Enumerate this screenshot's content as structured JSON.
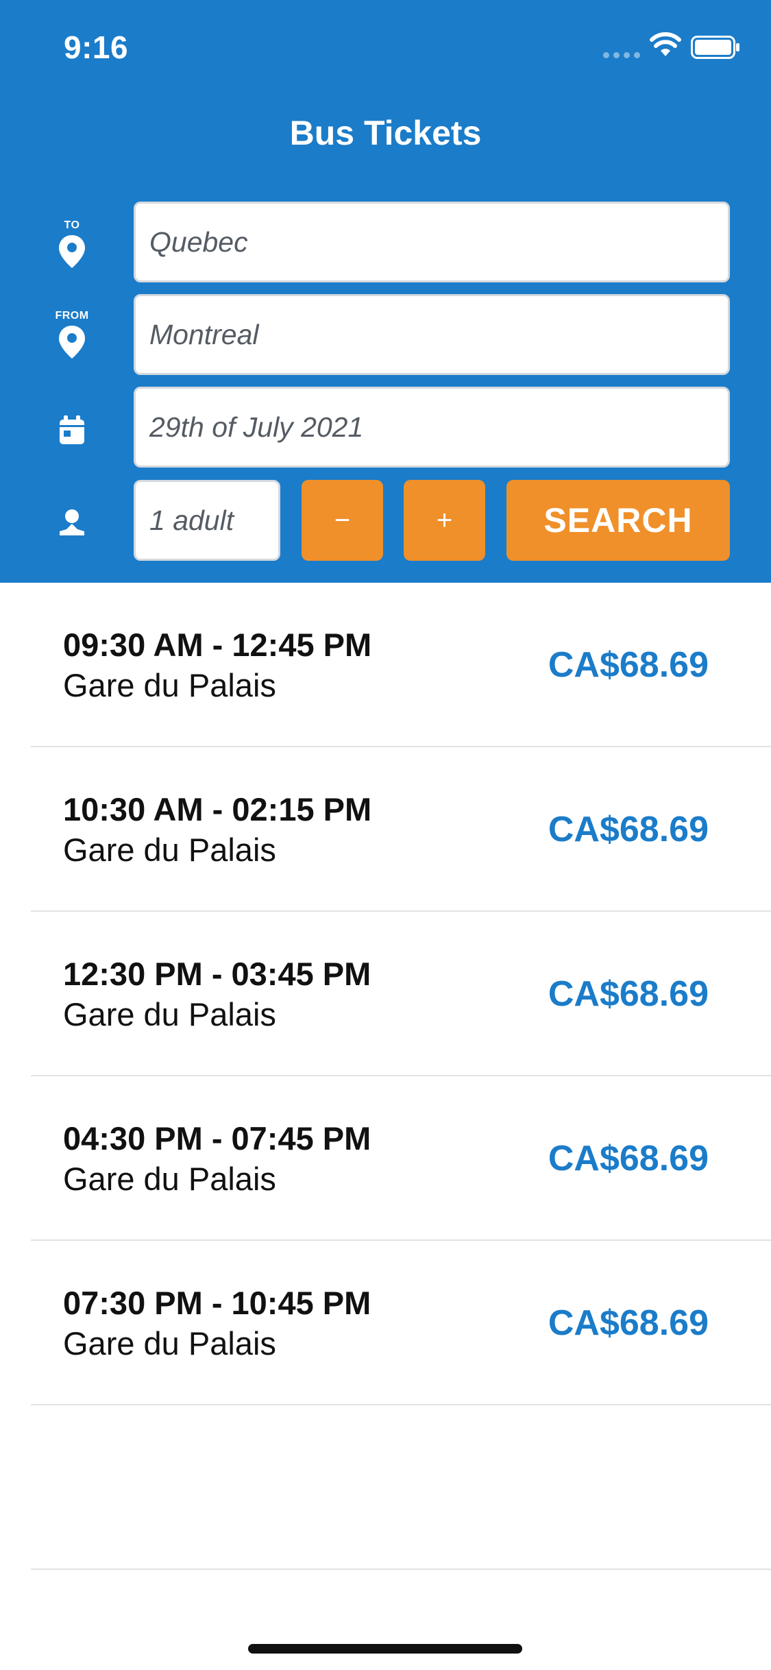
{
  "status_bar": {
    "time": "9:16"
  },
  "header": {
    "title": "Bus Tickets"
  },
  "form": {
    "to": {
      "label": "TO",
      "value": "Quebec"
    },
    "from": {
      "label": "FROM",
      "value": "Montreal"
    },
    "date": {
      "value": "29th of July 2021"
    },
    "passengers": {
      "value": "1 adult"
    },
    "minus_label": "−",
    "plus_label": "+",
    "search_label": "SEARCH"
  },
  "results": [
    {
      "time": "09:30 AM - 12:45 PM",
      "station": "Gare du Palais",
      "price": "CA$68.69"
    },
    {
      "time": "10:30 AM - 02:15 PM",
      "station": "Gare du Palais",
      "price": "CA$68.69"
    },
    {
      "time": "12:30 PM - 03:45 PM",
      "station": "Gare du Palais",
      "price": "CA$68.69"
    },
    {
      "time": "04:30 PM - 07:45 PM",
      "station": "Gare du Palais",
      "price": "CA$68.69"
    },
    {
      "time": "07:30 PM - 10:45 PM",
      "station": "Gare du Palais",
      "price": "CA$68.69"
    }
  ],
  "colors": {
    "header_bg": "#1b7cc9",
    "accent_orange": "#f0902a",
    "price_blue": "#1b7cc9"
  },
  "icons": {
    "to": "location-pin-icon",
    "from": "location-pin-icon",
    "date": "calendar-icon",
    "passengers": "person-icon"
  }
}
